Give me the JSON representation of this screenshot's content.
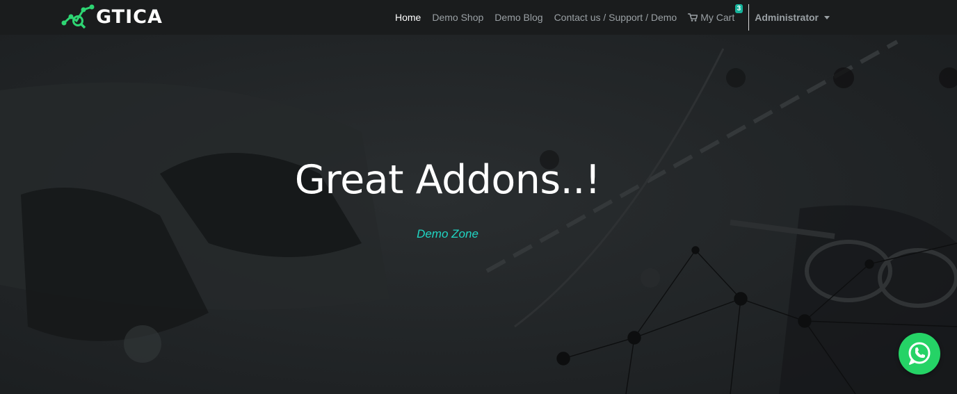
{
  "brand": {
    "logo_text": "GTICA"
  },
  "nav": {
    "items": [
      {
        "label": "Home",
        "active": true
      },
      {
        "label": "Demo Shop"
      },
      {
        "label": "Demo Blog"
      },
      {
        "label": "Contact us / Support / Demo"
      }
    ],
    "cart": {
      "label": "My Cart",
      "count": "3",
      "icon": "shopping-cart-icon"
    },
    "user": {
      "label": "Administrator"
    }
  },
  "hero": {
    "title": "Great Addons..!",
    "subtitle": "Demo Zone"
  },
  "whatsapp": {
    "icon": "whatsapp-icon"
  },
  "colors": {
    "accent": "#20d6c4",
    "brand_green": "#2ed573",
    "whatsapp_green": "#25d366",
    "navbar_bg": "#1a1c1d"
  }
}
